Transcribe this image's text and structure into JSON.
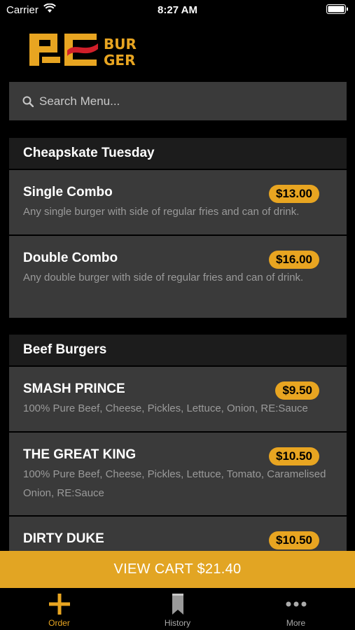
{
  "status_bar": {
    "carrier": "Carrier",
    "time": "8:27 AM"
  },
  "logo": {
    "line1": "BUR",
    "line2": "GER"
  },
  "search": {
    "placeholder": "Search Menu..."
  },
  "sections": [
    {
      "title": "Cheapskate Tuesday",
      "items": [
        {
          "name": "Single Combo",
          "price": "$13.00",
          "description": "Any single burger with side of regular fries and can of drink."
        },
        {
          "name": "Double Combo",
          "price": "$16.00",
          "description": "Any double burger with side of regular fries and can of drink."
        }
      ]
    },
    {
      "title": "Beef Burgers",
      "items": [
        {
          "name": "SMASH PRINCE",
          "price": "$9.50",
          "description": "100% Pure Beef, Cheese, Pickles, Lettuce, Onion, RE:Sauce"
        },
        {
          "name": "THE GREAT KING",
          "price": "$10.50",
          "description": "100% Pure Beef, Cheese, Pickles, Lettuce, Tomato, Caramelised Onion, RE:Sauce"
        },
        {
          "name": "DIRTY DUKE",
          "price": "$10.50",
          "description": ""
        }
      ]
    }
  ],
  "cart": {
    "label": "VIEW CART $21.40"
  },
  "tabs": [
    {
      "label": "Order",
      "icon": "plus-icon",
      "active": true
    },
    {
      "label": "History",
      "icon": "bookmark-icon",
      "active": false
    },
    {
      "label": "More",
      "icon": "more-dots-icon",
      "active": false
    }
  ],
  "colors": {
    "accent": "#E8A521",
    "background": "#000000",
    "card": "#3A3A3A",
    "header": "#1C1C1C"
  }
}
